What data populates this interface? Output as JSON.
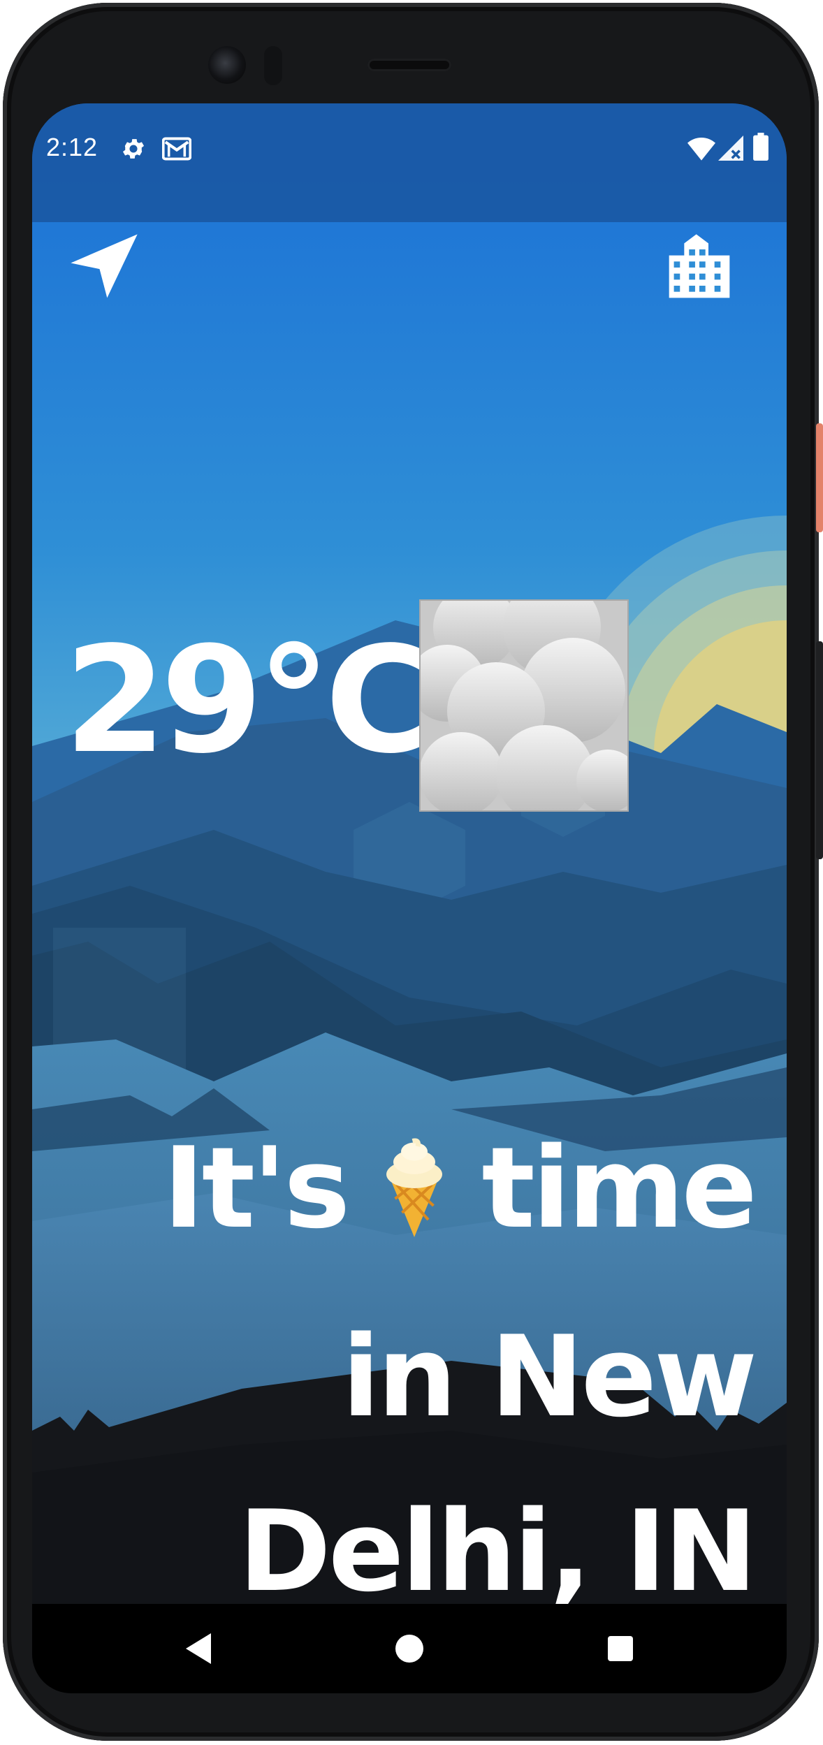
{
  "status_bar": {
    "time": "2:12",
    "left_icons": [
      "gear-icon",
      "gmail-icon"
    ],
    "right_icons": [
      "wifi-icon",
      "cell-signal-icon",
      "battery-icon"
    ]
  },
  "toolbar": {
    "location_button_icon": "navigation-arrow-icon",
    "city_button_icon": "city-buildings-icon"
  },
  "weather": {
    "temperature": "29",
    "unit": "°C",
    "condition_icon": "cloud-icon"
  },
  "message": {
    "part1": "It's",
    "emoji": "ice-cream-icon",
    "part2": "time",
    "line2": "in New",
    "line3": "Delhi, IN"
  },
  "nav_bar": {
    "buttons": [
      "back-triangle-icon",
      "home-circle-icon",
      "recents-square-icon"
    ]
  },
  "colors": {
    "sky_top": "#1b6fd3",
    "sky_bottom": "#4aa6d8",
    "sun": "#d9cf86",
    "mountain_dark": "#1c3f5f",
    "foreground": "#15171b"
  }
}
